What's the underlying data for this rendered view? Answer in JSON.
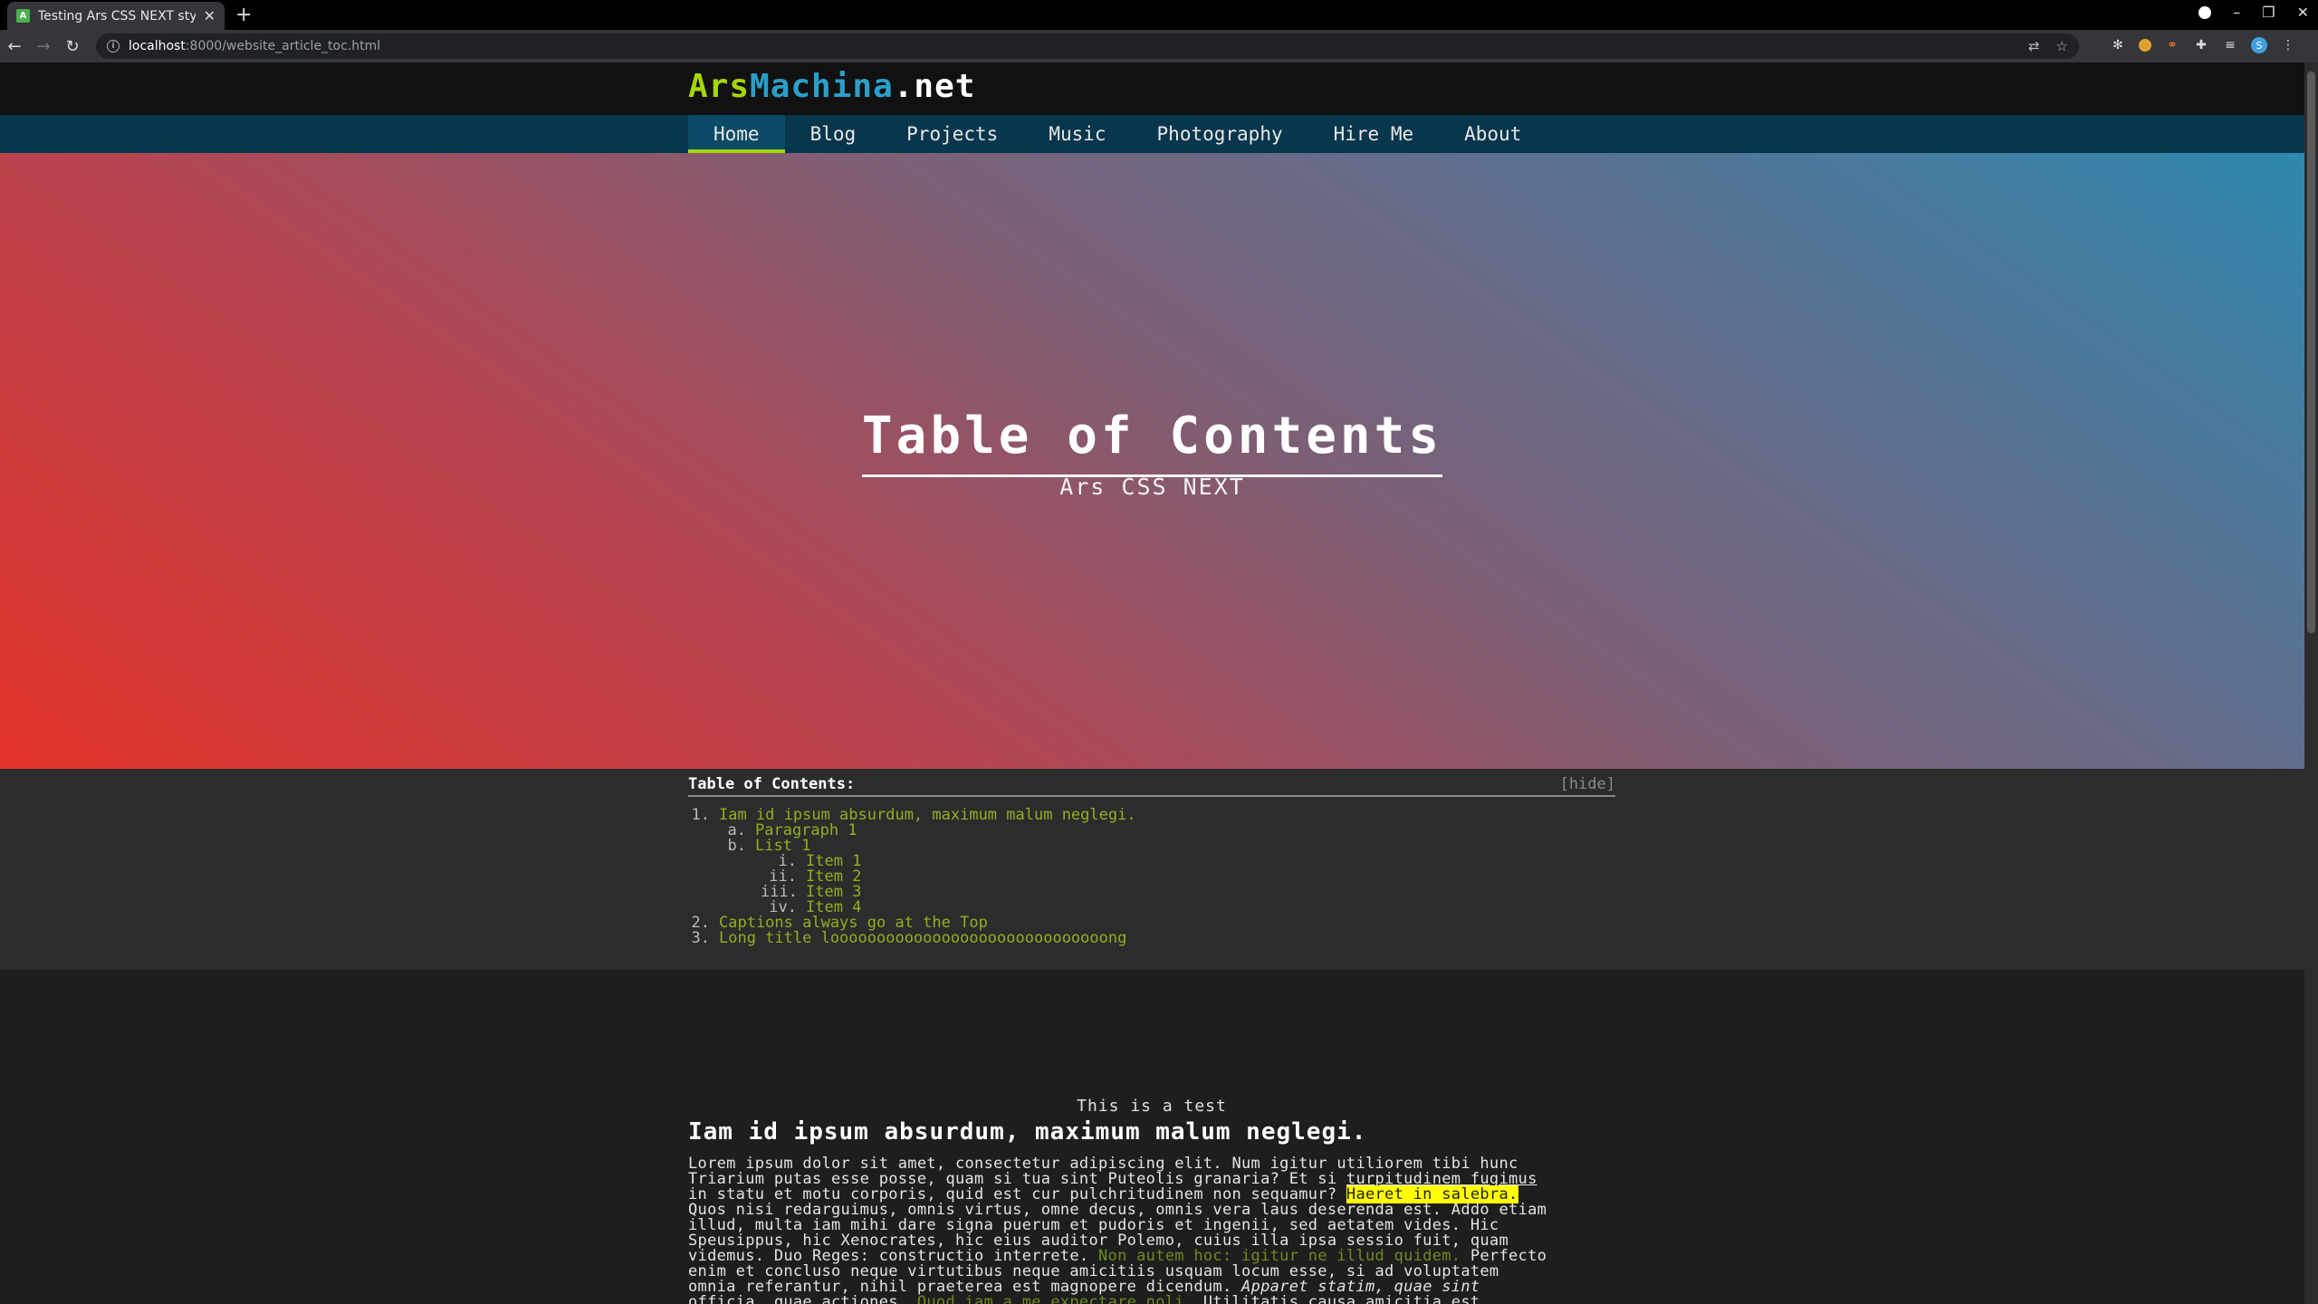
{
  "browser": {
    "tab_title": "Testing Ars CSS NEXT styling",
    "tab_favicon": "A",
    "url_host": "localhost",
    "url_path": ":8000/website_article_toc.html"
  },
  "site": {
    "logo_part1": "Ars",
    "logo_part2": "Machina",
    "logo_part3": ".net",
    "nav": [
      "Home",
      "Blog",
      "Projects",
      "Music",
      "Photography",
      "Hire Me",
      "About"
    ],
    "active_nav": "Home",
    "colors": {
      "accent_green": "#a6d608",
      "accent_blue": "#2a9fc9",
      "nav_bg": "#08364c",
      "hero_start": "#e3342a",
      "hero_end": "#2e88ae"
    }
  },
  "hero": {
    "title": "Table of Contents",
    "subtitle": "Ars CSS NEXT"
  },
  "toc": {
    "heading": "Table of Contents:",
    "hide_label": "[hide]",
    "items": [
      {
        "num": "1.",
        "label": "Iam id ipsum absurdum, maximum malum neglegi.",
        "level": 0
      },
      {
        "num": "a.",
        "label": "Paragraph 1",
        "level": 1
      },
      {
        "num": "b.",
        "label": "List 1",
        "level": 1
      },
      {
        "num": "i.",
        "label": "Item 1",
        "level": 2
      },
      {
        "num": "ii.",
        "label": "Item 2",
        "level": 2
      },
      {
        "num": "iii.",
        "label": "Item 3",
        "level": 2
      },
      {
        "num": "iv.",
        "label": "Item 4",
        "level": 2
      },
      {
        "num": "2.",
        "label": "Captions always go at the Top",
        "level": 0
      },
      {
        "num": "3.",
        "label": "Long title loooooooooooooooooooooooooooooong",
        "level": 0
      }
    ]
  },
  "article": {
    "caption": "This is a test",
    "heading": "Iam id ipsum absurdum, maximum malum neglegi.",
    "p_line1": "Lorem ipsum dolor sit amet, consectetur adipiscing elit. Num igitur utiliorem tibi hunc",
    "p_line2a": "Triarium putas esse posse, quam si tua sint Puteolis granaria? Et si ",
    "p_line2u": "turpitudinem fugimus",
    "p_line3a": "in statu et motu corporis, quid est cur pulchritudinem non sequamur? ",
    "p_line3hl": "Haeret in salebra.",
    "p_line4": "Quos nisi redarguimus, omnis virtus, omne decus, omnis vera laus deserenda est. Addo etiam",
    "p_line5": "illud, multa iam mihi dare signa puerum et pudoris et ingenii, sed aetatem vides. Hic",
    "p_line6": "Speusippus, hic Xenocrates, hic eius auditor Polemo, cuius illa ipsa sessio fuit, quam",
    "p_line7a": "videmus. Duo Reges: constructio interrete. ",
    "p_line7g": "Non autem hoc: igitur ne illud quidem.",
    "p_line7b": " Perfecto",
    "p_line8": "enim et concluso neque virtutibus neque amicitiis usquam locum esse, si ad voluptatem",
    "p_line9a": "omnia referantur, nihil praeterea est magnopere dicendum. ",
    "p_line9i": "Apparet statim, quae sint",
    "p_line10a": "officia, quae actiones. ",
    "p_line10g": "Quod iam a me expectare noli.",
    "p_line10b": " Utilitatis causa amicitia est"
  }
}
